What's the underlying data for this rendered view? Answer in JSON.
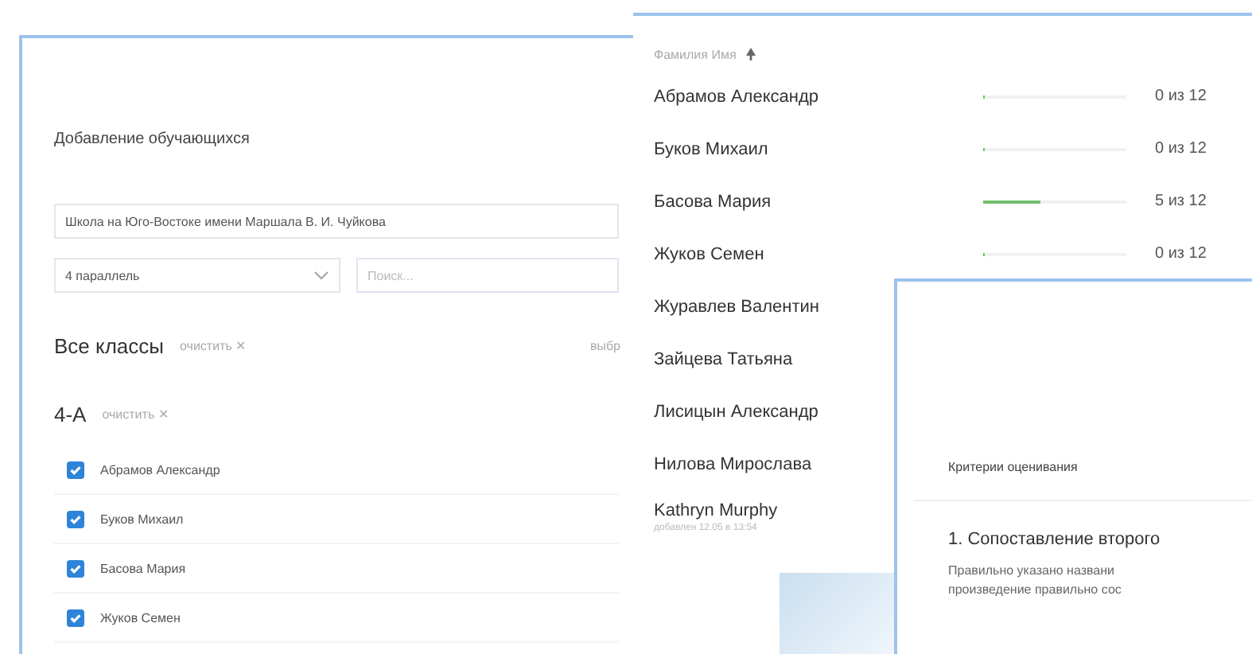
{
  "add_students": {
    "title": "Добавление обучающихся",
    "school_field": {
      "value": "Школа на Юго-Востоке имени Маршала В. И. Чуйкова"
    },
    "grade_select": {
      "value": "4 параллель"
    },
    "search_field": {
      "placeholder": "Поиск..."
    },
    "all_classes": {
      "title": "Все классы",
      "action": "очистить ✕",
      "right_label": "выбр"
    },
    "class_group": {
      "title": "4-А",
      "action": "очистить ✕"
    },
    "students": [
      {
        "name": "Абрамов Александр",
        "checked": true
      },
      {
        "name": "Буков Михаил",
        "checked": true
      },
      {
        "name": "Басова Мария",
        "checked": true
      },
      {
        "name": "Жуков Семен",
        "checked": true
      }
    ]
  },
  "progress_list": {
    "header": "Фамилия Имя",
    "rows": [
      {
        "name": "Абрамов Александр",
        "level": 0,
        "reading": "0 из 12"
      },
      {
        "name": "Буков Михаил",
        "level": 0,
        "reading": "0 из 12"
      },
      {
        "name": "Басова Мария",
        "level": 0.4,
        "reading": "5 из 12"
      },
      {
        "name": "Жуков Семен",
        "level": 0,
        "reading": "0 из 12"
      },
      {
        "name": "Журавлев Валентин"
      },
      {
        "name": "Зайцева Татьяна"
      },
      {
        "name": "Лисицын Александр"
      },
      {
        "name": "Нилова Мирослава"
      },
      {
        "name": "Kathryn Murphy",
        "subtitle": "добавлен 12.05 в 13:54"
      }
    ]
  },
  "criteria": {
    "title": "Критерии оценивания",
    "item_title": "1. Сопоставление второго",
    "lines": [
      "Правильно указано названи",
      "произведение правильно сос"
    ]
  }
}
